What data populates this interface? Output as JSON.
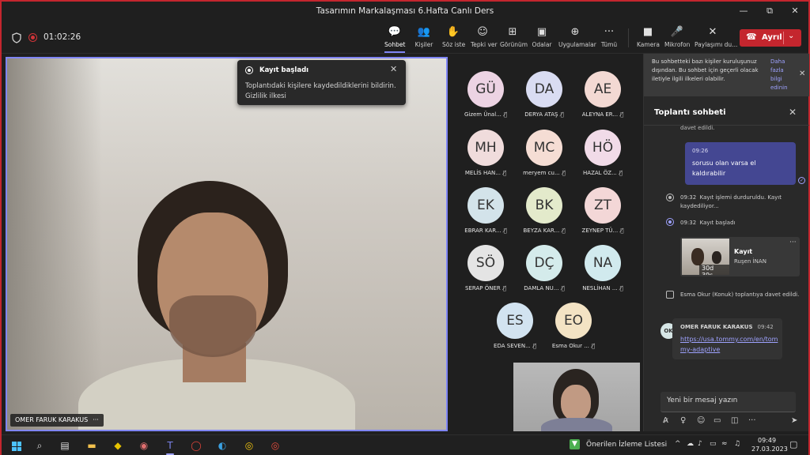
{
  "window": {
    "title": "Tasarımın Markalaşması 6.Hafta Canlı Ders",
    "minimize": "—",
    "maximize": "⧉",
    "close": "✕"
  },
  "meeting": {
    "timer": "01:02:26",
    "toolbar": [
      {
        "label": "Sohbet",
        "icon": "💬"
      },
      {
        "label": "Kişiler",
        "icon": "👥"
      },
      {
        "label": "Söz iste",
        "icon": "✋"
      },
      {
        "label": "Tepki ver",
        "icon": "☺"
      },
      {
        "label": "Görünüm",
        "icon": "⊞"
      },
      {
        "label": "Odalar",
        "icon": "▣"
      },
      {
        "label": "Uygulamalar",
        "icon": "⊕"
      },
      {
        "label": "Tümü",
        "icon": "···"
      },
      {
        "label": "Kamera",
        "icon": "■"
      },
      {
        "label": "Mikrofon",
        "icon": "🎤"
      },
      {
        "label": "Paylaşımı du...",
        "icon": "✕"
      }
    ],
    "leave": {
      "label": "Ayrıl",
      "phone_icon": "☎",
      "chevron": "⌄"
    }
  },
  "main_video": {
    "name": "OMER FARUK KARAKUS",
    "more": "···"
  },
  "toast": {
    "title": "Kayıt başladı",
    "body": "Toplantıdaki kişilere kaydedildiklerini bildirin.",
    "link": "Gizlilik ilkesi",
    "close": "✕"
  },
  "participants": [
    {
      "initials": "GÜ",
      "name": "Gizem Ünal...",
      "color": "#ecd3e3"
    },
    {
      "initials": "DA",
      "name": "DERYA ATAŞ",
      "color": "#d9dcf2"
    },
    {
      "initials": "AE",
      "name": "ALEYNA ER...",
      "color": "#f3d9d3"
    },
    {
      "initials": "MH",
      "name": "MELİS HAN...",
      "color": "#f0dcdc"
    },
    {
      "initials": "MC",
      "name": "meryem cu...",
      "color": "#f5ddd4"
    },
    {
      "initials": "HÖ",
      "name": "HAZAL ÖZ...",
      "color": "#f1dbe8"
    },
    {
      "initials": "EK",
      "name": "EBRAR KAR...",
      "color": "#d3e3ea"
    },
    {
      "initials": "BK",
      "name": "BEYZA KAR...",
      "color": "#e3eacb"
    },
    {
      "initials": "ZT",
      "name": "ZEYNEP TÜ...",
      "color": "#f3d7d7"
    },
    {
      "initials": "SÖ",
      "name": "SERAP ÖNER",
      "color": "#e4e4e4"
    },
    {
      "initials": "DÇ",
      "name": "DAMLA NU...",
      "color": "#d4ebeb"
    },
    {
      "initials": "NA",
      "name": "NESLİHAN ...",
      "color": "#d1eaee"
    },
    {
      "initials": "ES",
      "name": "EDA SEVEN...",
      "color": "#d2e3f0"
    },
    {
      "initials": "EO",
      "name": "Esma Okur ...",
      "color": "#f3e3c4"
    }
  ],
  "chat": {
    "banner_text": "Bu sohbetteki bazı kişiler kuruluşunuz dışından. Bu sohbet için geçerli olacak iletiyle ilgili ilkeleri olabilir.",
    "banner_link": "Daha fazla bilgi edinin",
    "title": "Toplantı sohbeti",
    "prev_fragment": "davet edildi.",
    "my_message": {
      "time": "09:26",
      "text": "sorusu olan varsa el kaldırabilir"
    },
    "event1": {
      "time": "09:32",
      "text": "Kayıt işlemi durduruldu. Kayıt kaydediliyor..."
    },
    "event2": {
      "time": "09:32",
      "text": "Kayıt başladı"
    },
    "recording": {
      "title": "Kayıt",
      "owner": "Ruşen İNAN",
      "duration": "30d 39s"
    },
    "event3": "Esma Okur (Konuk) toplantıya davet edildi.",
    "their_message": {
      "initials": "OK",
      "name": "OMER FARUK KARAKUS",
      "time": "09:42",
      "link": "https://usa.tommy.com/en/tommy-adaptive"
    },
    "compose_placeholder": "Yeni bir mesaj yazın"
  },
  "taskbar": {
    "weather": "Önerilen İzleme Listesi",
    "time": "09:49",
    "date": "27.03.2023"
  }
}
